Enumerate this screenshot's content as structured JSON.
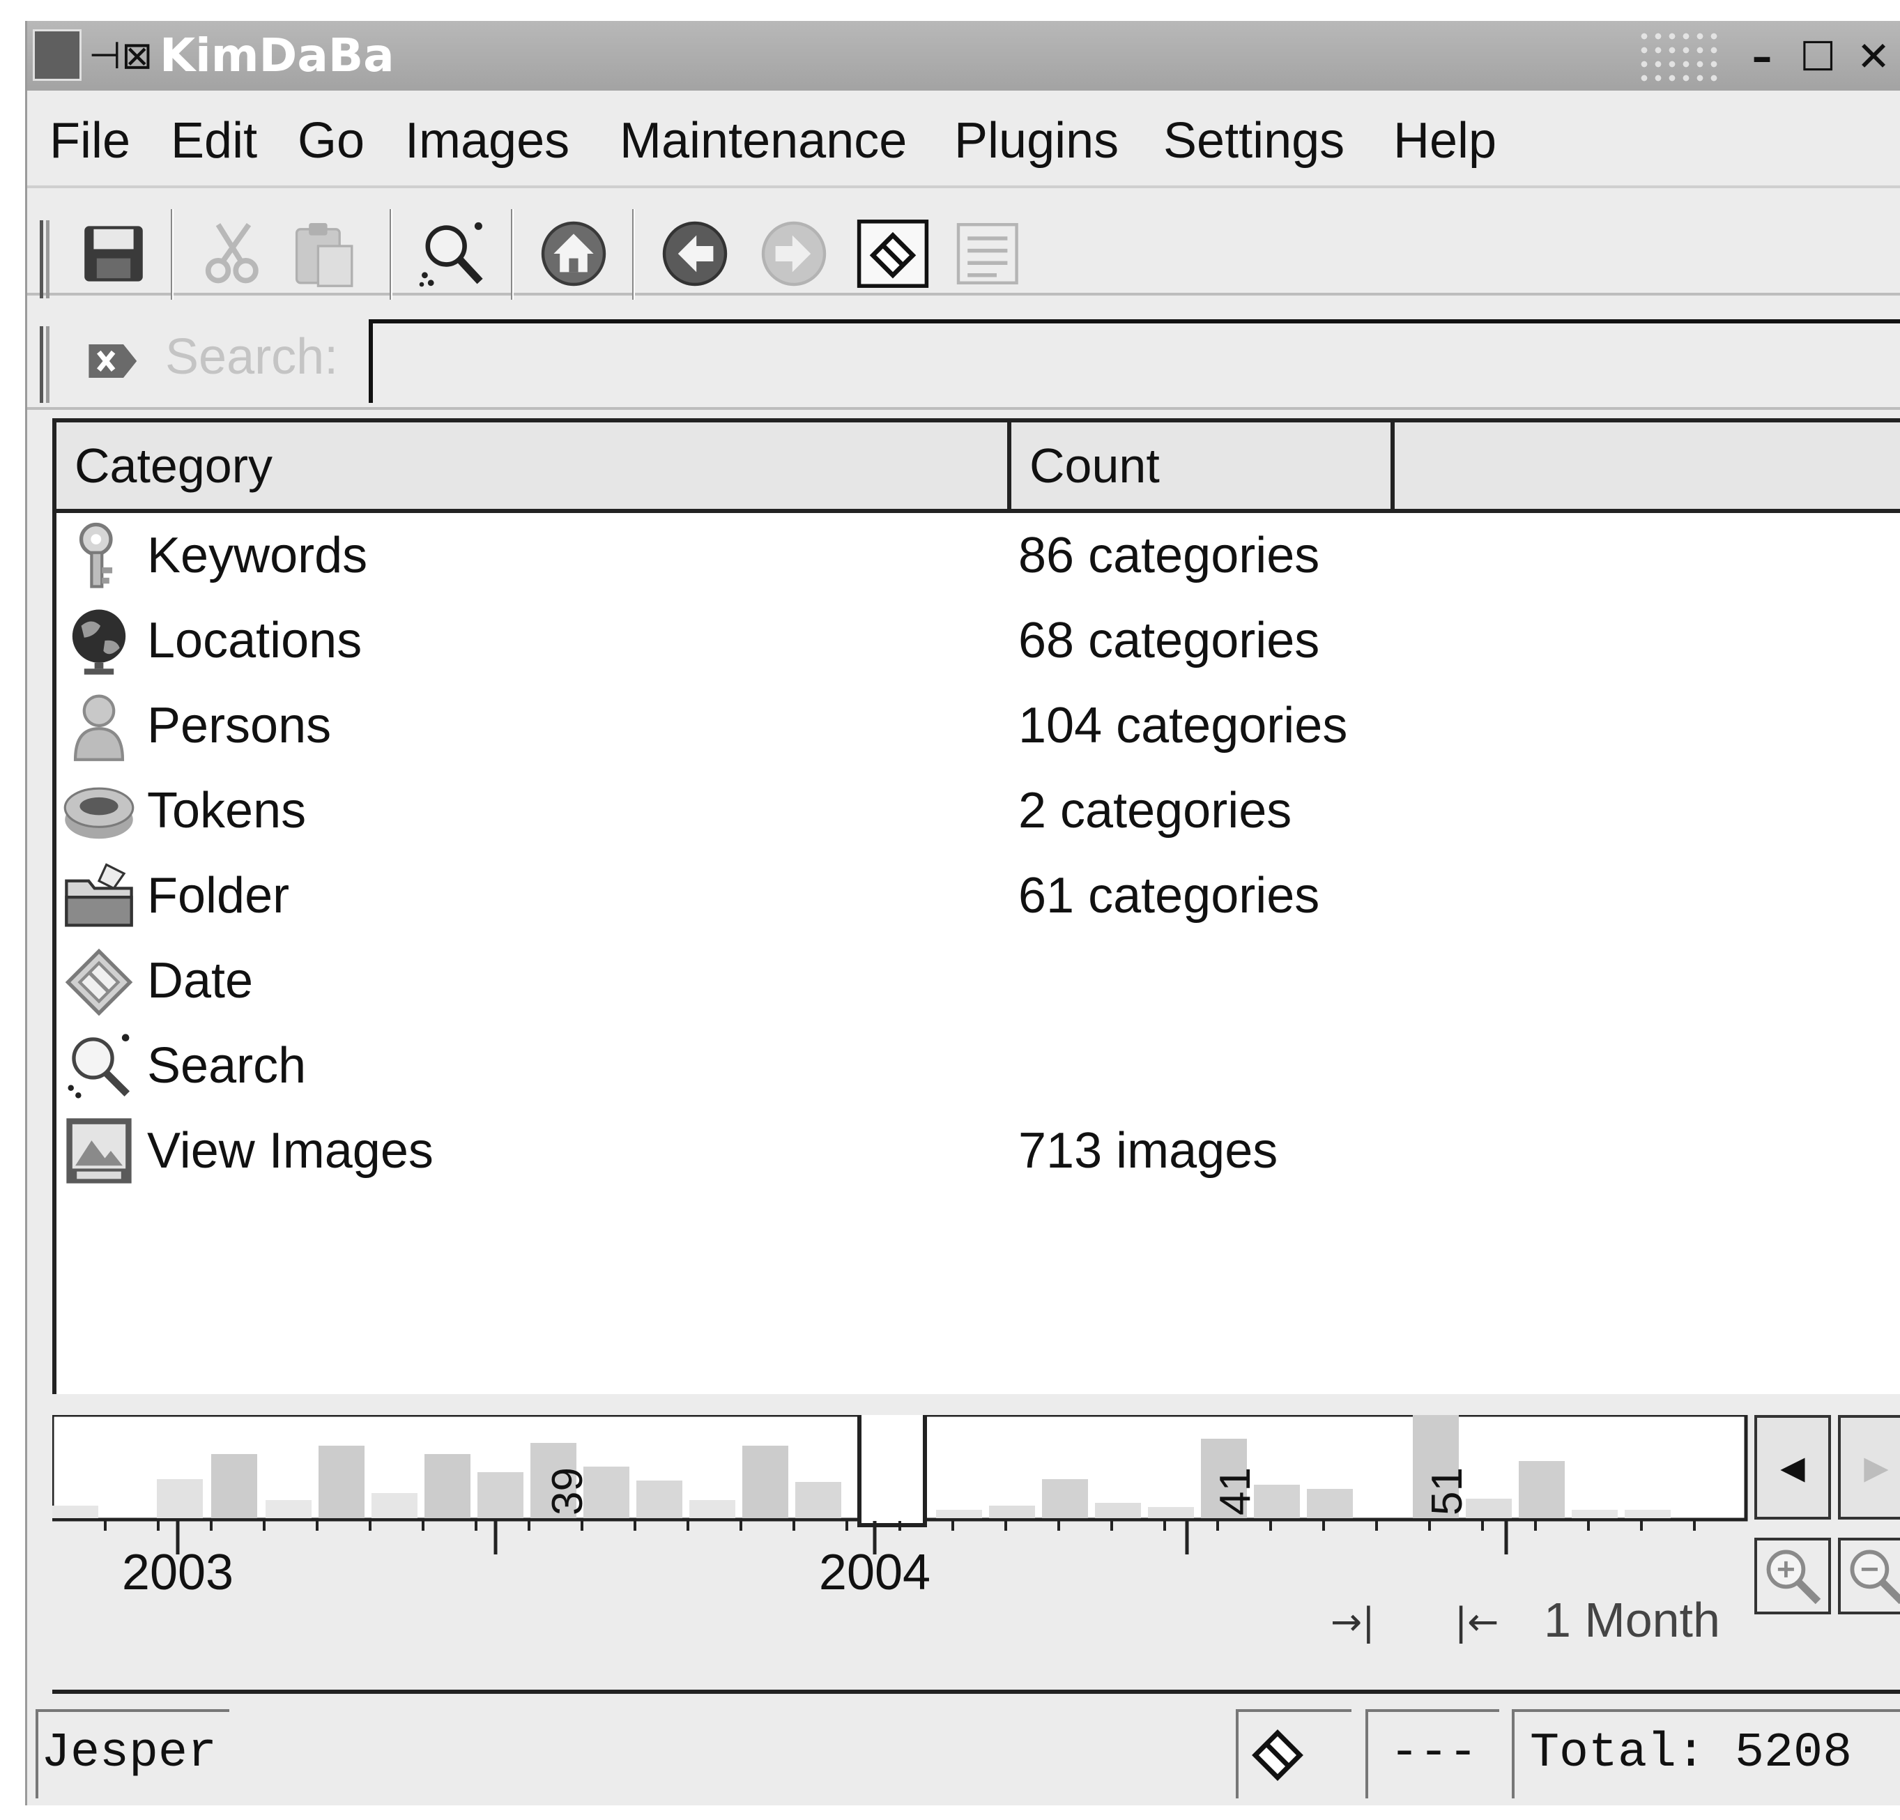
{
  "window": {
    "title": "KimDaBa",
    "controls": {
      "minimize": "–",
      "maximize": "☐",
      "close": "✕"
    }
  },
  "menu": {
    "items": [
      "File",
      "Edit",
      "Go",
      "Images",
      "Maintenance",
      "Plugins",
      "Settings",
      "Help"
    ]
  },
  "toolbar": {
    "buttons": [
      "save-icon",
      "cut-icon",
      "paste-icon",
      "search-icon",
      "home-icon",
      "back-icon",
      "forward-icon",
      "date-icon",
      "list-view-icon"
    ]
  },
  "search": {
    "label": "Search:",
    "value": ""
  },
  "list": {
    "columns": {
      "category": "Category",
      "count": "Count"
    },
    "rows": [
      {
        "name": "Keywords",
        "count": "86 categories",
        "icon": "keywords-icon"
      },
      {
        "name": "Locations",
        "count": "68 categories",
        "icon": "globe-icon"
      },
      {
        "name": "Persons",
        "count": "104 categories",
        "icon": "person-icon"
      },
      {
        "name": "Tokens",
        "count": "2 categories",
        "icon": "tokens-icon"
      },
      {
        "name": "Folder",
        "count": "61 categories",
        "icon": "folder-icon"
      },
      {
        "name": "Date",
        "count": "",
        "icon": "date-icon"
      },
      {
        "name": "Search",
        "count": "",
        "icon": "search-icon"
      },
      {
        "name": "View Images",
        "count": "713 images",
        "icon": "view-images-icon"
      }
    ]
  },
  "datebar": {
    "years": [
      "2003",
      "2004"
    ],
    "bar_labels": [
      "39",
      "41",
      "51"
    ],
    "resolution": "1 Month"
  },
  "status": {
    "user": "Jesper",
    "middle": "---",
    "total": "Total: 5208"
  },
  "colors": {
    "window_bg": "#ececec",
    "titlebar": "#a8a8a8",
    "histogram_bar": "#d4d4d4",
    "list_bg": "#ffffff"
  }
}
